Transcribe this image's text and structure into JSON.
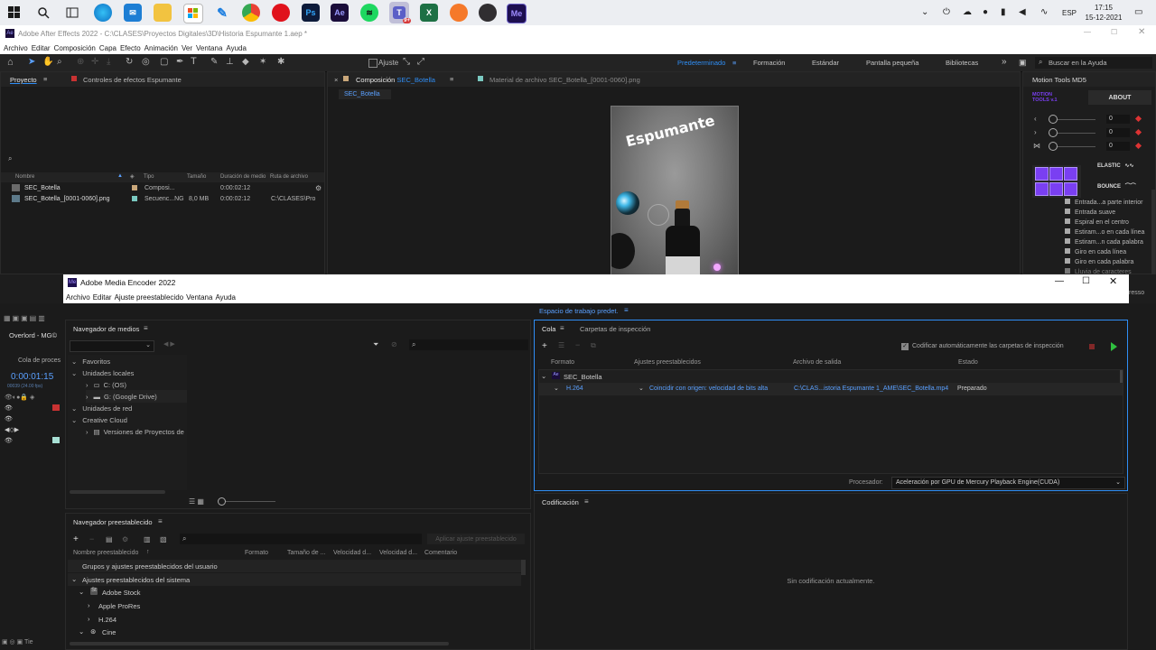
{
  "taskbar": {
    "apps": [
      "windows-start",
      "search",
      "task-view",
      "edge",
      "mail",
      "file-explorer",
      "store",
      "pen",
      "chrome",
      "opera",
      "photoshop",
      "after-effects",
      "spotify",
      "teams",
      "excel",
      "blender",
      "obs",
      "media-encoder"
    ],
    "teams_badge": "9+",
    "language": "ESP",
    "time": "17:15",
    "date": "15-12-2021"
  },
  "ae": {
    "title": "Adobe After Effects 2022 - C:\\CLASES\\Proyectos Digitales\\3D\\Historia Espumante 1.aep *",
    "menu": [
      "Archivo",
      "Editar",
      "Composición",
      "Capa",
      "Efecto",
      "Animación",
      "Ver",
      "Ventana",
      "Ayuda"
    ],
    "toolbar": {
      "ajuste_label": "Ajuste",
      "workspaces": [
        "Predeterminado",
        "Formación",
        "Estándar",
        "Pantalla pequeña",
        "Bibliotecas"
      ],
      "more": "»",
      "search_placeholder": "Buscar en la Ayuda"
    },
    "project_panel": {
      "tab": "Proyecto",
      "effects_tab": "Controles de efectos Espumante",
      "columns": [
        "Nombre",
        "Tipo",
        "Tamaño",
        "Duración de medio",
        "Ruta de archivo"
      ],
      "items": [
        {
          "name": "SEC_Botella",
          "type": "Composi...",
          "size": "",
          "duration": "0:00:02:12",
          "path": ""
        },
        {
          "name": "SEC_Botella_[0001-0060].png",
          "type": "Secuenc...NG",
          "size": "8,0 MB",
          "duration": "0:00:02:12",
          "path": "C:\\CLASES\\Pro"
        }
      ]
    },
    "comp_panel": {
      "tab_prefix": "Composición",
      "tab_name": "SEC_Botella",
      "footage_tab": "Material de archivo  SEC_Botella_[0001-0060].png",
      "sub_tab": "SEC_Botella",
      "preview_text": "Espumante"
    },
    "motion_tools": {
      "title": "Motion Tools MD5",
      "logo": "MOTION TOOLS v.1",
      "about": "ABOUT",
      "sliders": [
        "0",
        "0",
        "0"
      ],
      "elastic": "ELASTIC",
      "bounce": "BOUNCE",
      "presets": [
        "Entrada...a parte interior",
        "Entrada suave",
        "Espiral en el centro",
        "Estiram...o en cada línea",
        "Estiram...n cada palabra",
        "Giro en cada línea",
        "Giro en cada palabra",
        "Lluvia de caracteres"
      ],
      "side_text": "resso"
    },
    "timeline": {
      "tab": "Overlord - MG©",
      "render_queue": "Cola de proces",
      "timecode": "0:00:01:15",
      "fps": "00039 (24.00 fps)",
      "bottom_text": "Tie",
      "right_label": "12f"
    }
  },
  "ame": {
    "title": "Adobe Media Encoder 2022",
    "menu": [
      "Archivo",
      "Editar",
      "Ajuste preestablecido",
      "Ventana",
      "Ayuda"
    ],
    "workspace": "Espacio de trabajo predet.",
    "media_browser": {
      "title": "Navegador de medios",
      "tree": [
        {
          "label": "Favoritos",
          "level": 0
        },
        {
          "label": "Unidades locales",
          "level": 0
        },
        {
          "label": "C: (OS)",
          "level": 1
        },
        {
          "label": "G: (Google Drive)",
          "level": 1
        },
        {
          "label": "Unidades de red",
          "level": 0
        },
        {
          "label": "Creative Cloud",
          "level": 0
        },
        {
          "label": "Versiones de Proyectos de",
          "level": 1
        }
      ]
    },
    "preset_browser": {
      "title": "Navegador preestablecido",
      "apply_button": "Aplicar ajuste preestablecido",
      "columns": [
        "Nombre preestablecido",
        "Formato",
        "Tamaño de ...",
        "Velocidad d...",
        "Velocidad d...",
        "Comentario"
      ],
      "rows": [
        {
          "label": "Grupos y ajustes preestablecidos del usuario",
          "level": 0
        },
        {
          "label": "Ajustes preestablecidos del sistema",
          "level": 0
        },
        {
          "label": "Adobe Stock",
          "level": 1
        },
        {
          "label": "Apple ProRes",
          "level": 2
        },
        {
          "label": "H.264",
          "level": 2
        },
        {
          "label": "Cine",
          "level": 1
        }
      ]
    },
    "queue": {
      "tab": "Cola",
      "watch_tab": "Carpetas de inspección",
      "auto_encode": "Codificar automáticamente las carpetas de inspección",
      "columns": [
        "Formato",
        "Ajustes preestablecidos",
        "Archivo de salida",
        "Estado"
      ],
      "group": "SEC_Botella",
      "item": {
        "format": "H.264",
        "preset": "Coincidir con origen: velocidad de bits alta",
        "output": "C:\\CLAS...istoria Espumante 1_AME\\SEC_Botella.mp4",
        "status": "Preparado"
      },
      "processor_label": "Procesador:",
      "processor_value": "Aceleración por GPU de Mercury Playback Engine(CUDA)"
    },
    "encoding": {
      "title": "Codificación",
      "message": "Sin codificación actualmente."
    }
  },
  "colors": {
    "accent": "#2f8ef5",
    "purple": "#7a3ff2",
    "play_green": "#2fbf3f",
    "stop_red": "#c83232"
  }
}
